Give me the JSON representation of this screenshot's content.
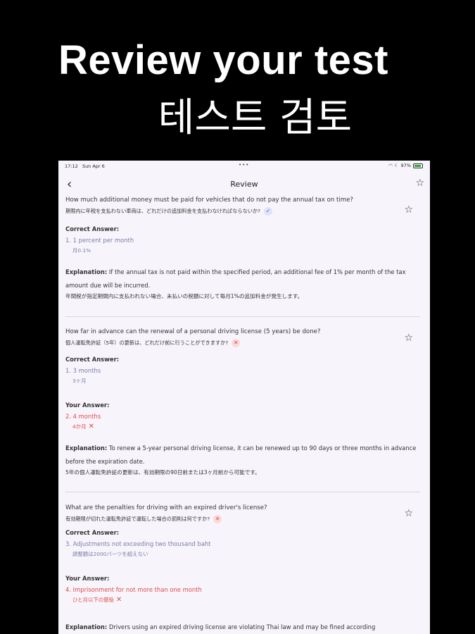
{
  "promo": {
    "title_en": "Review your test",
    "title_ko": "테스트 검토"
  },
  "status_bar": {
    "time": "17:12",
    "date": "Sun Apr 6",
    "dots": "•••",
    "battery": "97%"
  },
  "nav": {
    "back_icon": "‹",
    "title": "Review",
    "star_icon": "☆"
  },
  "questions": [
    {
      "text": "How much additional money must be paid for vehicles that do not pay the annual tax on time?",
      "text_jp": "期限内に年税を支払わない車両は、どれだけの追加料金を支払わなければならないか?",
      "status": "correct",
      "status_icon": "✓",
      "correct_label": "Correct Answer:",
      "correct_answer": "1. 1 percent per month",
      "correct_answer_jp": "月0.1%",
      "explanation_label": "Explanation:",
      "explanation": "If the annual tax is not paid within the specified period, an additional fee of 1% per month of the tax amount due will be incurred.",
      "explanation_jp": "年間税が指定期間内に支払われない場合、未払いの税額に対して毎月1%の追加料金が発生します。"
    },
    {
      "text": "How far in advance can the renewal of a personal driving license (5 years) be done?",
      "text_jp": "個人運転免許証（5年）の更新は、どれだけ前に行うことができますか?",
      "status": "wrong",
      "status_icon": "✕",
      "correct_label": "Correct Answer:",
      "correct_answer": "1. 3 months",
      "correct_answer_jp": "3ヶ月",
      "your_label": "Your Answer:",
      "your_answer": "2. 4 months",
      "your_answer_jp": "4か月",
      "explanation_label": "Explanation:",
      "explanation": "To renew a 5-year personal driving license, it can be renewed up to 90 days or three months in advance before the expiration date.",
      "explanation_jp": "5年の個人運転免許証の更新は、有効期限の90日前または3ヶ月前から可能です。"
    },
    {
      "text": "What are the penalties for driving with an expired driver's license?",
      "text_jp": "有効期限が切れた運転免許証で運転した場合の罰則は何ですか?",
      "status": "wrong",
      "status_icon": "✕",
      "correct_label": "Correct Answer:",
      "correct_answer": "3. Adjustments not exceeding two thousand baht",
      "correct_answer_jp": "調整額は2000バーツを超えない",
      "your_label": "Your Answer:",
      "your_answer": "4. Imprisonment for not more than one month",
      "your_answer_jp": "ひと月以下の懲役",
      "explanation_label": "Explanation:",
      "explanation": "Drivers using an expired driving license are violating Thai law and may be fined according"
    }
  ],
  "wrong_mark": "✕"
}
